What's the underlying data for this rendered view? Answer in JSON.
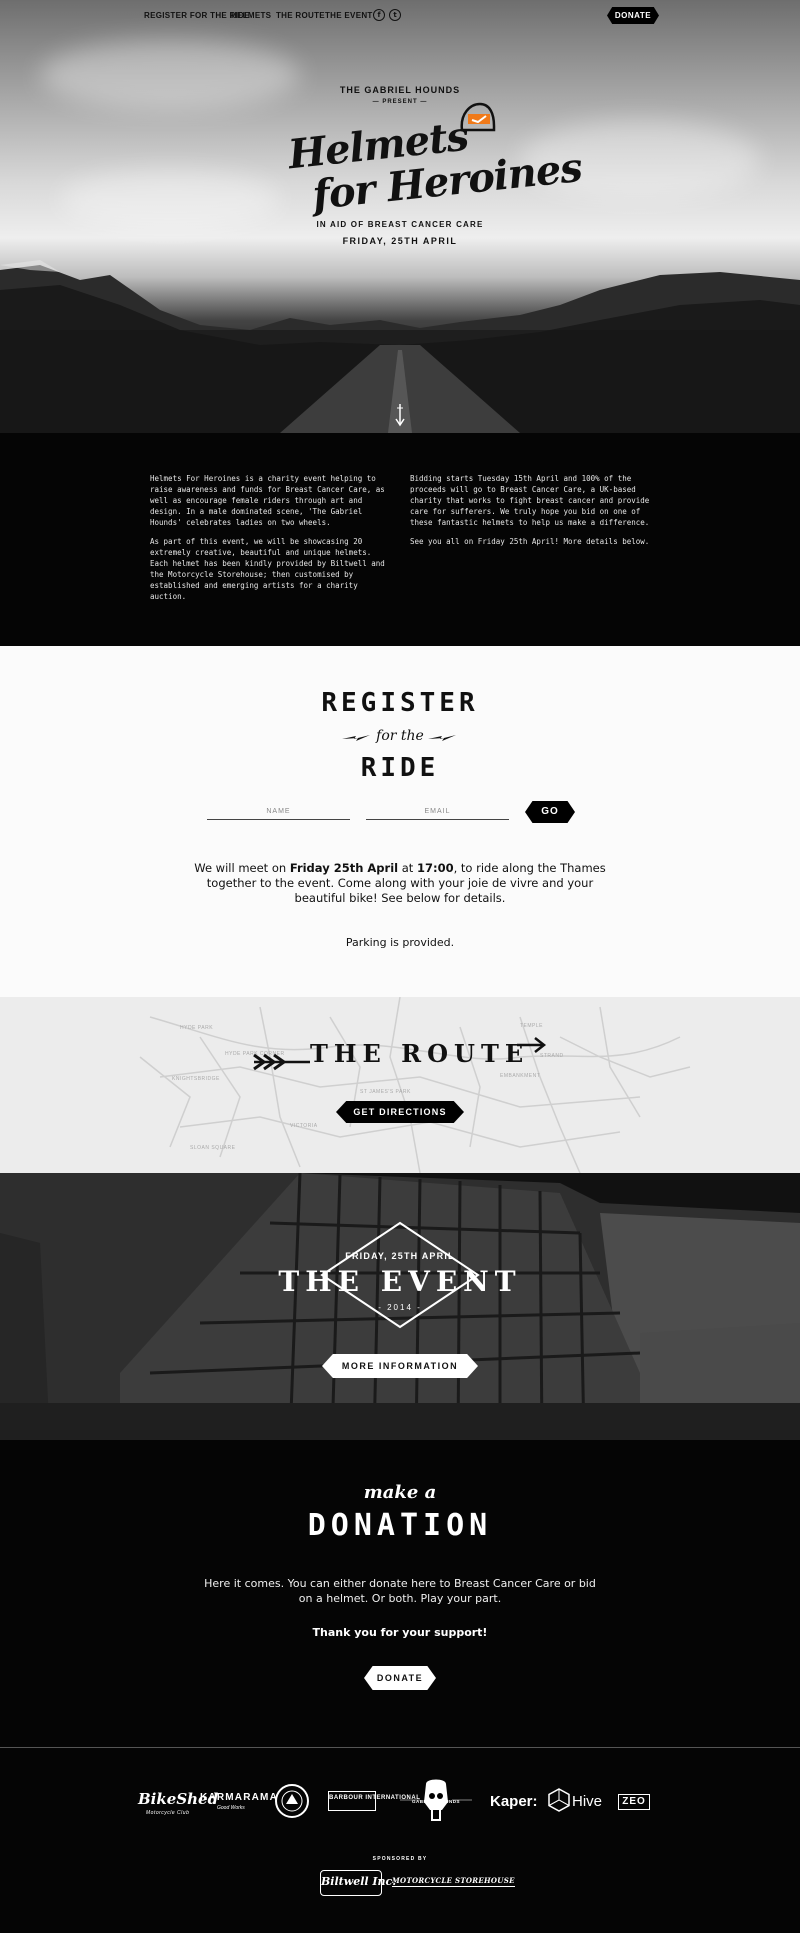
{
  "nav": {
    "links": [
      "REGISTER FOR THE RIDE",
      "HELMETS",
      "THE ROUTE",
      "THE EVENT"
    ],
    "social": [
      {
        "icon": "facebook-icon",
        "glyph": "f"
      },
      {
        "icon": "twitter-icon",
        "glyph": "t"
      }
    ],
    "donate_label": "DONATE"
  },
  "hero": {
    "presenter": "THE GABRIEL HOUNDS",
    "present": "— PRESENT —",
    "title_line1": "Helmets",
    "title_line2": "for Heroines",
    "aid": "IN AID OF BREAST CANCER CARE",
    "date": "FRIDAY, 25TH APRIL",
    "accent_color": "#f07a1a"
  },
  "intro": {
    "left": [
      "Helmets For Heroines is a charity event helping to raise awareness and funds for Breast Cancer Care, as well as encourage female riders through art and design. In a male dominated scene, 'The Gabriel Hounds' celebrates ladies on two wheels.",
      "As part of this event, we will be showcasing 20 extremely creative, beautiful and unique helmets. Each helmet has been kindly provided by Biltwell and the Motorcycle Storehouse; then customised by established and emerging artists for a charity auction."
    ],
    "right": [
      "Bidding starts Tuesday 15th April and 100% of the proceeds will go to Breast Cancer Care, a UK-based charity that works to fight breast cancer and provide care for sufferers.  We truly hope you bid on one of these fantastic helmets to help us make a difference.",
      "See you all on Friday 25th April! More details below."
    ]
  },
  "register": {
    "title_top": "REGISTER",
    "title_mid": "for the",
    "title_bottom": "RIDE",
    "name_placeholder": "NAME",
    "email_placeholder": "EMAIL",
    "go_label": "GO",
    "text_pre": "We will meet on ",
    "text_bold_date": "Friday 25th April",
    "text_at": " at ",
    "text_bold_time": "17:00",
    "text_post": ", to ride along the Thames together to the event. Come along with your joie de vivre and your beautiful bike! See below for details.",
    "parking": "Parking is provided."
  },
  "route": {
    "title": "THE ROUTE",
    "button_label": "GET DIRECTIONS",
    "map_labels": [
      "HYDE PARK",
      "HYDE PARK CORNER",
      "KNIGHTSBRIDGE",
      "ST JAMES'S PARK",
      "VICTORIA",
      "SLOAN SQUARE",
      "TEMPLE",
      "STRAND",
      "EMBANKMENT"
    ]
  },
  "event": {
    "date": "FRIDAY, 25TH APRIL",
    "title": "THE EVENT",
    "year": "- 2014 -",
    "button_label": "MORE INFORMATION"
  },
  "donation": {
    "make": "make a",
    "title": "DONATION",
    "text": "Here it comes. You can either donate here to Breast Cancer Care or bid on a helmet. Or both. Play your part.",
    "thanks": "Thank you for your support!",
    "button_label": "DONATE"
  },
  "footer": {
    "bikeshed": "BikeShed",
    "bikeshed_sub": "Motorcycle Club",
    "karmarama": "KARMARAMA",
    "karmarama_sub": "Good Works",
    "barbour": "BARBOUR INTERNATIONAL",
    "gabriel": "GABRIEL    HOUNDS",
    "kaper": "Kaper:",
    "hive": "Hive",
    "zeo": "ZEO",
    "sponsored_by": "SPONSORED BY",
    "biltwell": "Biltwell Inc.",
    "moto_storehouse": "MOTORCYCLE STOREHOUSE"
  }
}
